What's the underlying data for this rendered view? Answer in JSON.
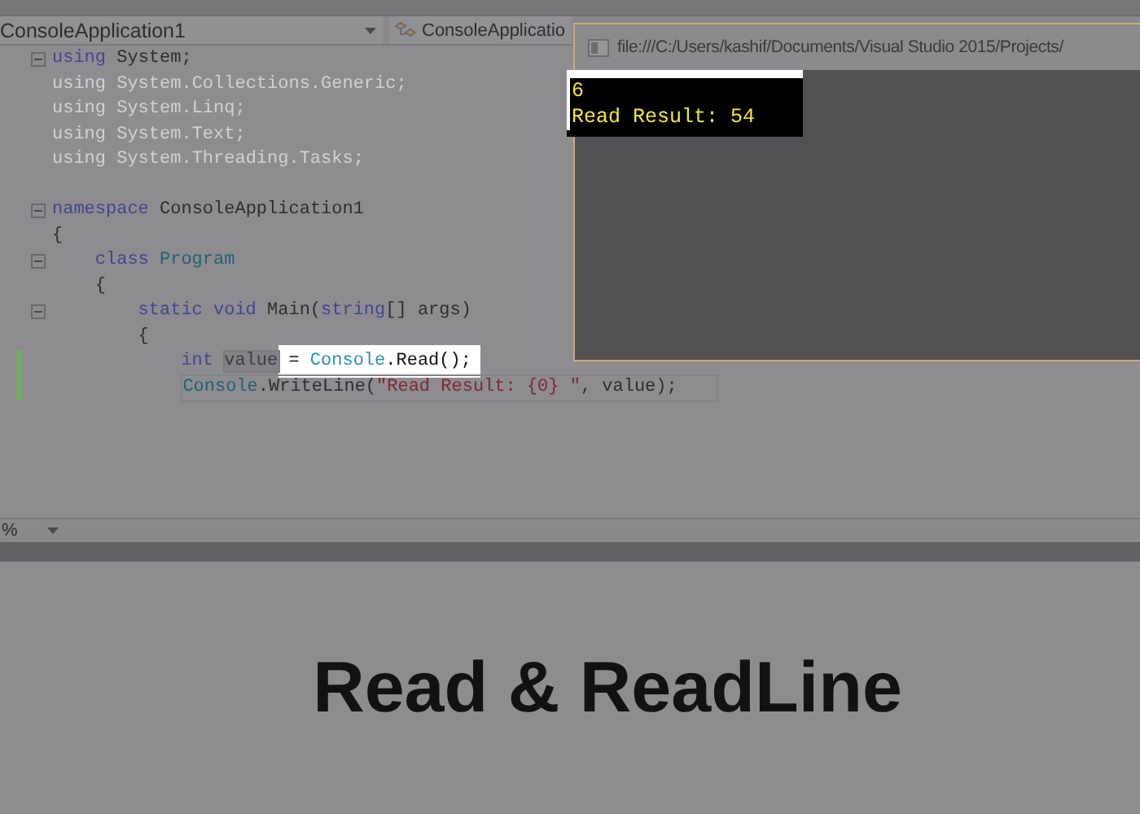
{
  "navigation_bar": {
    "project_dropdown": "ConsoleApplication1",
    "class_dropdown": "ConsoleApplicatio"
  },
  "code_lines": [
    {
      "kind": "code",
      "foldable": true,
      "changed": false,
      "current": false,
      "segments": [
        {
          "kind": "keyword",
          "text": "using"
        },
        {
          "kind": "plain",
          "text": " System;"
        }
      ]
    },
    {
      "kind": "code",
      "foldable": false,
      "changed": false,
      "current": false,
      "segments": [
        {
          "kind": "unused",
          "text": "using System.Collections.Generic;"
        }
      ]
    },
    {
      "kind": "code",
      "foldable": false,
      "changed": false,
      "current": false,
      "segments": [
        {
          "kind": "unused",
          "text": "using System.Linq;"
        }
      ]
    },
    {
      "kind": "code",
      "foldable": false,
      "changed": false,
      "current": false,
      "segments": [
        {
          "kind": "unused",
          "text": "using System.Text;"
        }
      ]
    },
    {
      "kind": "code",
      "foldable": false,
      "changed": false,
      "current": false,
      "segments": [
        {
          "kind": "unused",
          "text": "using System.Threading.Tasks;"
        }
      ]
    },
    {
      "kind": "blank"
    },
    {
      "kind": "code",
      "foldable": true,
      "changed": false,
      "current": false,
      "segments": [
        {
          "kind": "keyword",
          "text": "namespace"
        },
        {
          "kind": "plain",
          "text": " ConsoleApplication1"
        }
      ]
    },
    {
      "kind": "code",
      "foldable": false,
      "changed": false,
      "current": false,
      "segments": [
        {
          "kind": "plain",
          "text": "{"
        }
      ],
      "children": [
        {
          "kind": "code",
          "foldable": true,
          "changed": false,
          "current": false,
          "segments": [
            {
              "kind": "keyword",
              "text": "class "
            },
            {
              "kind": "type",
              "text": "Program"
            }
          ]
        },
        {
          "kind": "code",
          "foldable": false,
          "changed": false,
          "current": false,
          "segments": [
            {
              "kind": "plain",
              "text": "{"
            }
          ],
          "children": [
            {
              "kind": "code",
              "foldable": true,
              "changed": false,
              "current": false,
              "segments": [
                {
                  "kind": "keyword",
                  "text": "static void"
                },
                {
                  "kind": "plain",
                  "text": " Main("
                },
                {
                  "kind": "keyword",
                  "text": "string"
                },
                {
                  "kind": "plain",
                  "text": "[] args)"
                }
              ]
            },
            {
              "kind": "code",
              "foldable": false,
              "changed": false,
              "current": false,
              "segments": [
                {
                  "kind": "plain",
                  "text": "{"
                }
              ],
              "children": [
                {
                  "kind": "code",
                  "foldable": false,
                  "changed": true,
                  "current": false,
                  "segments": [
                    {
                      "kind": "keyword",
                      "text": "int "
                    },
                    {
                      "kind": "reference",
                      "text": "value"
                    },
                    {
                      "kind": "highlight_plain",
                      "text": " = "
                    },
                    {
                      "kind": "highlight_type",
                      "text": "Console"
                    },
                    {
                      "kind": "highlight_plain",
                      "text": ".Read();"
                    }
                  ]
                },
                {
                  "kind": "code",
                  "foldable": false,
                  "changed": true,
                  "current": true,
                  "segments": [
                    {
                      "kind": "type",
                      "text": "Console"
                    },
                    {
                      "kind": "plain",
                      "text": ".WriteLine("
                    },
                    {
                      "kind": "string",
                      "text": "\"Read Result: {0} \""
                    },
                    {
                      "kind": "plain",
                      "text": ", value);"
                    }
                  ]
                }
              ]
            }
          ]
        }
      ]
    }
  ],
  "zoom_level": "%",
  "console_window": {
    "title": "file:///C:/Users/kashif/Documents/Visual Studio 2015/Projects/",
    "output_lines": [
      "6",
      "Read Result: 54"
    ]
  },
  "caption": "Read & ReadLine"
}
